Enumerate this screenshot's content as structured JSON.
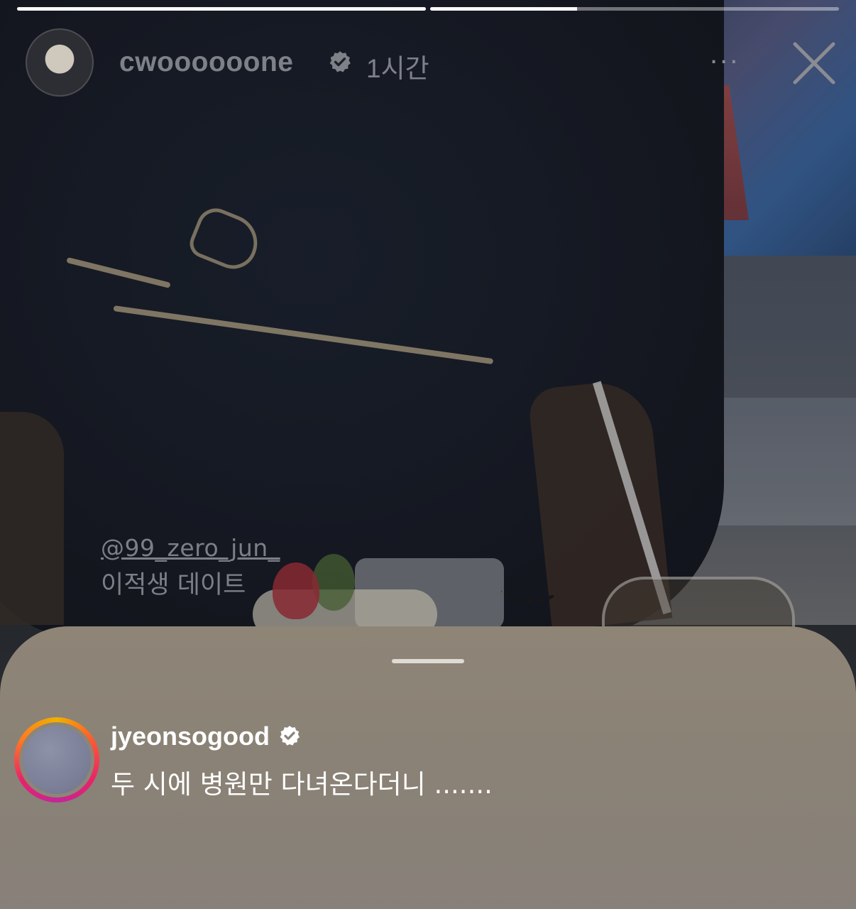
{
  "story": {
    "progress": [
      1.0,
      0.36
    ],
    "username": "cwoooooone",
    "time": "1시간",
    "more_label": "...",
    "verified_icon": "verified-badge-icon",
    "close_icon": "close-icon"
  },
  "sticker": {
    "mention": "@99_zero_jun_",
    "caption": "이적생 데이트"
  },
  "comment": {
    "username": "jyeonsogood",
    "text": "두 시에 병원만 다녀온다더니 .......",
    "ring_colors": [
      "#f0b000",
      "#ff5a2e",
      "#e7236b",
      "#c3259a"
    ]
  }
}
